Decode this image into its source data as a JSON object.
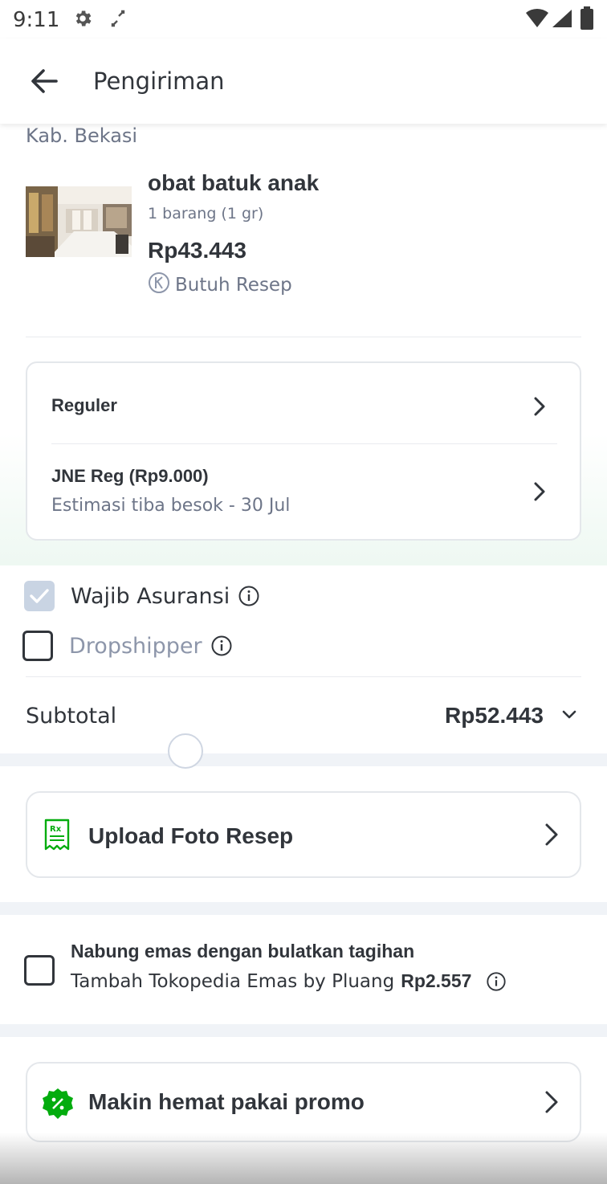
{
  "status_bar": {
    "time": "9:11"
  },
  "app_bar": {
    "title": "Pengiriman"
  },
  "location": {
    "text": "Kab. Bekasi"
  },
  "product": {
    "name": "obat batuk anak",
    "quantity": "1 barang (1 gr)",
    "price": "Rp43.443",
    "badge": "Butuh Resep"
  },
  "shipping": {
    "service": "Reguler",
    "courier": "JNE Reg (Rp9.000)",
    "estimate": "Estimasi tiba besok - 30 Jul"
  },
  "options": {
    "insurance": {
      "label": "Wajib Asuransi",
      "checked": true
    },
    "dropshipper": {
      "label": "Dropshipper",
      "checked": false
    }
  },
  "subtotal": {
    "label": "Subtotal",
    "value": "Rp52.443"
  },
  "prescription": {
    "label": "Upload Foto Resep"
  },
  "emas": {
    "title": "Nabung emas dengan bulatkan tagihan",
    "subtitle": "Tambah Tokopedia Emas by Pluang",
    "amount": "Rp2.557",
    "checked": false
  },
  "promo": {
    "label": "Makin hemat pakai promo"
  },
  "colors": {
    "accent_green": "#03ac0e",
    "text_primary": "#31353b",
    "text_secondary": "#6d7588"
  }
}
